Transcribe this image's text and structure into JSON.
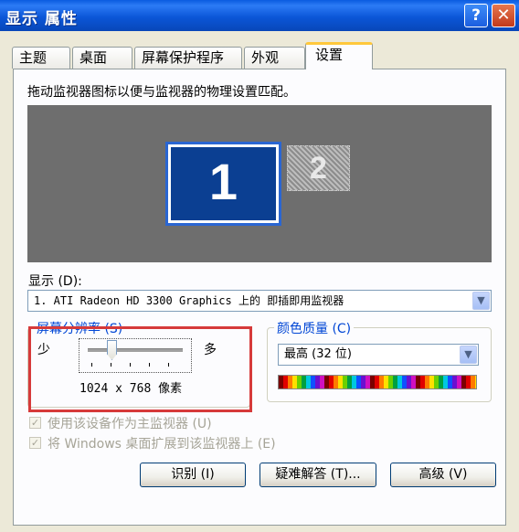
{
  "window": {
    "title": "显示 属性",
    "help_glyph": "?",
    "close_glyph": "✕"
  },
  "tabs": [
    {
      "label": "主题",
      "active": false
    },
    {
      "label": "桌面",
      "active": false
    },
    {
      "label": "屏幕保护程序",
      "active": false
    },
    {
      "label": "外观",
      "active": false
    },
    {
      "label": "设置",
      "active": true
    }
  ],
  "settings": {
    "instruction": "拖动监视器图标以便与监视器的物理设置匹配。",
    "monitors": [
      {
        "number": "1",
        "selected": true
      },
      {
        "number": "2",
        "selected": false
      }
    ],
    "display_label": "显示 (D):",
    "display_value": "1. ATI Radeon HD 3300 Graphics 上的 即插即用监视器",
    "resolution": {
      "legend": "屏幕分辨率 (S)",
      "less_label": "少",
      "more_label": "多",
      "value_text": "1024 x 768 像素",
      "slider_position": 0.25
    },
    "color_quality": {
      "legend": "颜色质量 (C)",
      "selected": "最高 (32 位)"
    },
    "checkboxes": [
      {
        "label": "使用该设备作为主监视器 (U)",
        "checked": true,
        "enabled": false
      },
      {
        "label": "将 Windows 桌面扩展到该监视器上 (E)",
        "checked": true,
        "enabled": false
      }
    ],
    "buttons": {
      "identify": "识别 (I)",
      "troubleshoot": "疑难解答 (T)...",
      "advanced": "高级 (V)"
    }
  },
  "colors": {
    "highlight_box": "#D63A3A",
    "title_bar": "#0A5BE0",
    "monitor_selected": "#0B3F92"
  }
}
